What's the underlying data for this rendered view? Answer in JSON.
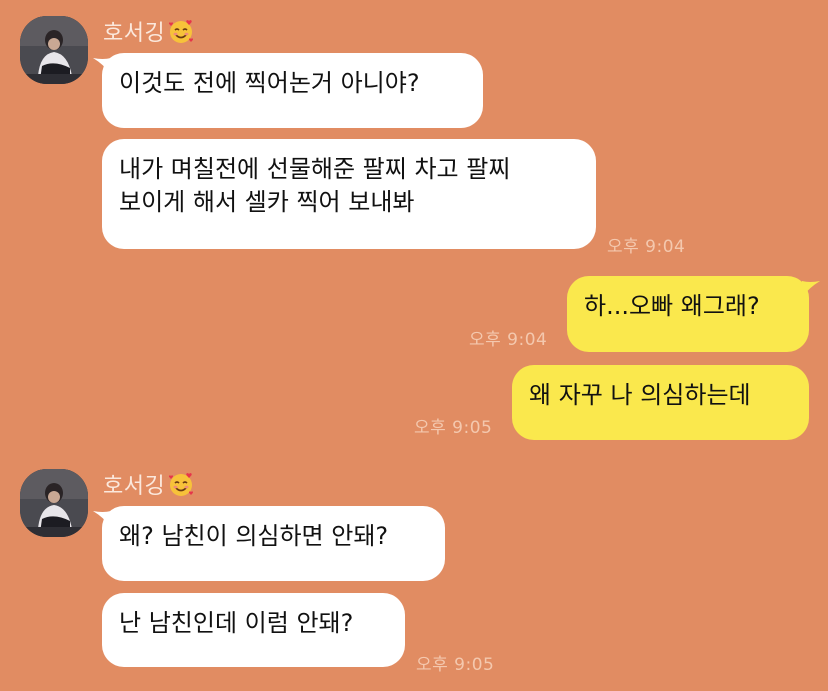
{
  "colors": {
    "background": "#e18c62",
    "incoming_bubble": "#ffffff",
    "outgoing_bubble": "#fae84d",
    "timestamp": "#f4c8ae",
    "sender_name": "#fbe8dc"
  },
  "groups": [
    {
      "sender": {
        "name": "호서깅",
        "emoji": "smiling-face-with-hearts-icon"
      },
      "messages": [
        {
          "text": "이것도 전에 찍어논거 아니야?"
        },
        {
          "lines": [
            "내가 며칠전에 선물해준 팔찌 차고 팔찌",
            "보이게 해서 셀카 찍어 보내봐"
          ],
          "time": "오후 9:04"
        }
      ]
    },
    {
      "outgoing": [
        {
          "text": "하...오빠 왜그래?",
          "time": "오후 9:04"
        },
        {
          "text": "왜 자꾸 나 의심하는데",
          "time": "오후 9:05"
        }
      ]
    },
    {
      "sender": {
        "name": "호서깅",
        "emoji": "smiling-face-with-hearts-icon"
      },
      "messages": [
        {
          "text": "왜? 남친이 의심하면 안돼?"
        },
        {
          "text": "난 남친인데 이럼 안돼?",
          "time": "오후 9:05"
        }
      ]
    }
  ]
}
